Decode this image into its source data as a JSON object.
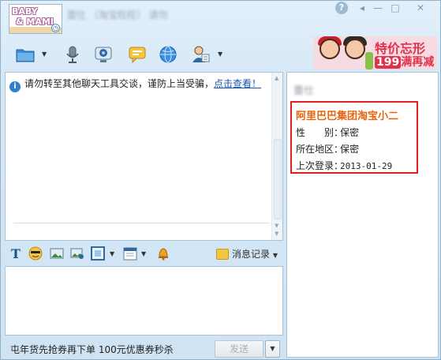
{
  "window": {
    "avatar_logo_line1": "BABY",
    "avatar_logo_line2": "& MAMI",
    "title_blurred": "蕾仕 （淘宝旺旺） 请勿",
    "help_label": "?",
    "pin_label": "◂",
    "min_label": "—",
    "max_label": "□",
    "close_label": "✕"
  },
  "toolbar": {
    "items": [
      {
        "name": "folder-icon",
        "has_dropdown": true
      },
      {
        "name": "microphone-icon",
        "has_dropdown": false
      },
      {
        "name": "webcam-icon",
        "has_dropdown": false
      },
      {
        "name": "chat-bubble-icon",
        "has_dropdown": false
      },
      {
        "name": "globe-icon",
        "has_dropdown": false
      },
      {
        "name": "user-card-icon",
        "has_dropdown": true
      }
    ]
  },
  "banner": {
    "line1": "特价忘形",
    "line2_big": "199",
    "line2_rest": "满再减"
  },
  "message_panel": {
    "notice_text": "请勿转至其他聊天工具交谈，谨防上当受骗，",
    "notice_link": "点击查看！"
  },
  "format_bar": {
    "icons": [
      "font-icon",
      "emoji-icon",
      "image-icon",
      "screenshot-icon",
      "frame-icon",
      "calendar-icon",
      "bell-icon"
    ],
    "history_label": "消息记录"
  },
  "bottom": {
    "promo_text": "屯年货先抢券再下单 100元优惠券秒杀",
    "send_label": "发送",
    "send_drop_label": "▼"
  },
  "info_panel": {
    "name_blurred": "蕾仕",
    "title": "阿里巴巴集团淘宝小二",
    "rows": [
      {
        "label": "性　　别：",
        "value": "保密"
      },
      {
        "label": "所在地区：",
        "value": "保密"
      },
      {
        "label": "上次登录：",
        "value": "2013-01-29"
      }
    ]
  },
  "colors": {
    "accent_orange": "#e8630e",
    "highlight_border": "#e02020",
    "link_blue": "#1a55b0",
    "window_bg": "#d7e9f7"
  }
}
